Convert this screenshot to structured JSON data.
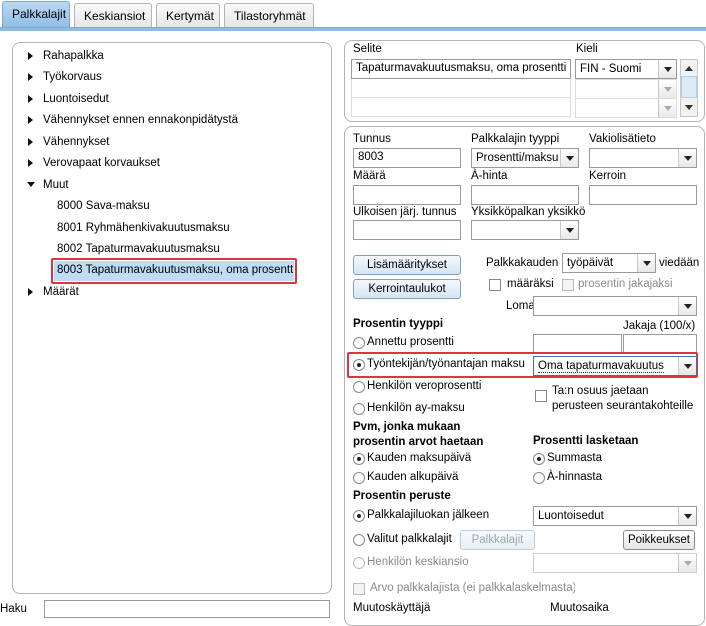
{
  "tabs": [
    "Palkkalajit",
    "Keskiansiot",
    "Kertymät",
    "Tilastoryhmät"
  ],
  "tree": {
    "groups": [
      "Rahapalkka",
      "Työkorvaus",
      "Luontoisedut",
      "Vähennykset ennen ennakonpidätystä",
      "Vähennykset",
      "Verovapaat korvaukset",
      "Muut"
    ],
    "children": [
      "8000 Sava-maksu",
      "8001 Ryhmähenkivakuutusmaksu",
      "8002 Tapaturmavakuutusmaksu",
      "8003 Tapaturmavakuutusmaksu, oma prosentti"
    ],
    "last": "Määrät"
  },
  "search": {
    "label": "Haku",
    "value": ""
  },
  "description": {
    "selite_label": "Selite",
    "kieli_label": "Kieli",
    "selite_value": "Tapaturmavakuutusmaksu, oma prosentti",
    "kieli_value": "FIN - Suomi"
  },
  "form": {
    "tunnus_label": "Tunnus",
    "tunnus_value": "8003",
    "tyyppi_label": "Palkkalajin tyyppi",
    "tyyppi_value": "Prosentti/maksu",
    "vakio_label": "Vakiolisätieto",
    "vakio_value": "",
    "maara_label": "Määrä",
    "ahinta_label": "À-hinta",
    "kerroin_label": "Kerroin",
    "ulkoisen_label": "Ulkoisen järj. tunnus",
    "yksikko_label": "Yksikköpalkan yksikkö",
    "lisamaaritykset_btn": "Lisämääritykset",
    "kerrointaulukot_btn": "Kerrointaulukot",
    "palkkakauden_label": "Palkkakauden",
    "palkkakauden_value": "työpäivät",
    "viedaan_label": "viedään",
    "maaraksi_label": "määräksi",
    "prosentin_jakajaksi_label": "prosentin jakajaksi",
    "loma_label": "Loma",
    "prosentin_tyyppi_title": "Prosentin tyyppi",
    "jakaja_label": "Jakaja (100/x)",
    "annettu_prosentti": "Annettu prosentti",
    "tyontekija_maksu": "Työntekijän/työnantajan maksu",
    "tyontekija_combo": "Oma tapaturmavakuutus",
    "henkilon_veroprosentti": "Henkilön veroprosentti",
    "henkilon_ay_maksu": "Henkilön ay-maksu",
    "tan_osuus": "Ta:n osuus jaetaan perusteen seurantakohteille",
    "pvm_title": "Pvm, jonka mukaan prosentin arvot haetaan",
    "kauden_maksupaiva": "Kauden maksupäivä",
    "kauden_alkupaiva": "Kauden alkupäivä",
    "prosentti_lasketaan_title": "Prosentti lasketaan",
    "summasta": "Summasta",
    "a_hinnasta": "À-hinnasta",
    "prosentin_peruste_title": "Prosentin peruste",
    "palkkalajiluokan_jalkeen": "Palkkalajiluokan jälkeen",
    "peruste_combo": "Luontoisedut",
    "valitut_palkkalajit": "Valitut palkkalajit",
    "palkkalajit_btn": "Palkkalajit",
    "poikkeukset_btn": "Poikkeukset",
    "henkilon_keskiansio": "Henkilön keskiansio",
    "arvo_palkkalajista": "Arvo palkkalajista (ei palkkalaskelmasta)",
    "muutoskayttaja_label": "Muutoskäyttäjä",
    "muutosaika_label": "Muutosaika"
  }
}
